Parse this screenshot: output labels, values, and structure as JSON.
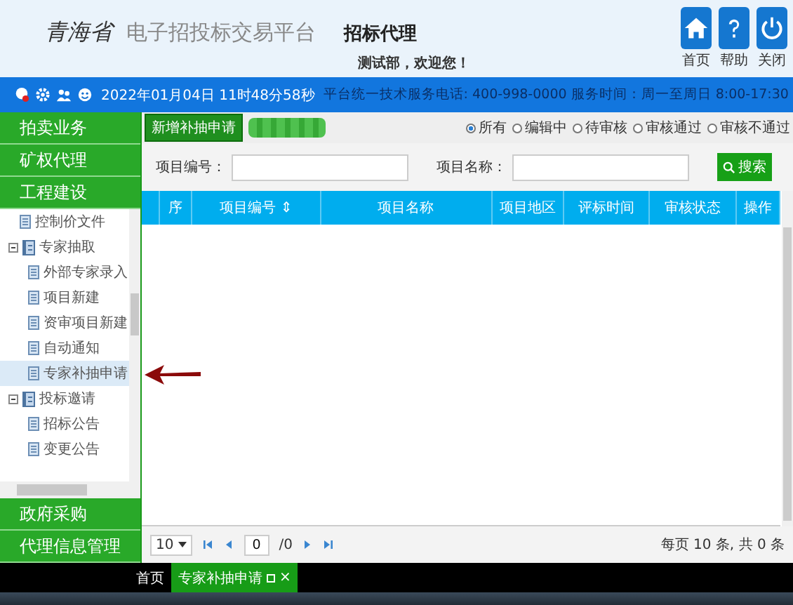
{
  "header": {
    "province": "青海省",
    "platform": "电子招投标交易平台",
    "module": "招标代理",
    "welcome": "测试部，欢迎您！",
    "buttons": [
      {
        "kind": "home",
        "label": "首页"
      },
      {
        "kind": "help",
        "label": "帮助"
      },
      {
        "kind": "power",
        "label": "关闭"
      }
    ]
  },
  "info_bar": {
    "datetime": "2022年01月04日 11时48分58秒",
    "notice": "平台统一技术服务电话: 400-998-0000 服务时间：周一至周日 8:00-17:30"
  },
  "sidebar": {
    "top_items": [
      "拍卖业务",
      "矿权代理",
      "工程建设"
    ],
    "tree": [
      {
        "label": "控制价文件",
        "kind": "leaf",
        "selected": false
      },
      {
        "label": "专家抽取",
        "kind": "folder",
        "expanded": true,
        "selected": false,
        "children": [
          {
            "label": "外部专家录入",
            "kind": "leaf",
            "selected": false
          },
          {
            "label": "项目新建",
            "kind": "leaf",
            "selected": false
          },
          {
            "label": "资审项目新建",
            "kind": "leaf",
            "selected": false
          },
          {
            "label": "自动通知",
            "kind": "leaf",
            "selected": false
          },
          {
            "label": "专家补抽申请",
            "kind": "leaf",
            "selected": true
          }
        ]
      },
      {
        "label": "投标邀请",
        "kind": "folder",
        "expanded": true,
        "selected": false,
        "children": [
          {
            "label": "招标公告",
            "kind": "leaf",
            "selected": false
          },
          {
            "label": "变更公告",
            "kind": "leaf",
            "selected": false
          }
        ]
      }
    ],
    "bottom_items": [
      "政府采购",
      "代理信息管理"
    ]
  },
  "toolbar": {
    "add_button": "新增补抽申请",
    "filters": [
      {
        "label": "所有",
        "selected": true
      },
      {
        "label": "编辑中",
        "selected": false
      },
      {
        "label": "待审核",
        "selected": false
      },
      {
        "label": "审核通过",
        "selected": false
      },
      {
        "label": "审核不通过",
        "selected": false
      }
    ]
  },
  "search": {
    "fields": [
      {
        "label": "项目编号："
      },
      {
        "label": "项目名称："
      }
    ],
    "button": "搜索"
  },
  "table": {
    "columns": [
      "序",
      "项目编号 ⇕",
      "项目名称",
      "项目地区",
      "评标时间",
      "审核状态",
      "操作"
    ]
  },
  "pager": {
    "page_size": "10",
    "page": "0",
    "total_pages": "/0",
    "summary": "每页 10 条, 共 0 条"
  },
  "tabs": [
    {
      "label": "首页",
      "selected": false
    },
    {
      "label": "专家补抽申请",
      "selected": true,
      "close": "×"
    }
  ]
}
